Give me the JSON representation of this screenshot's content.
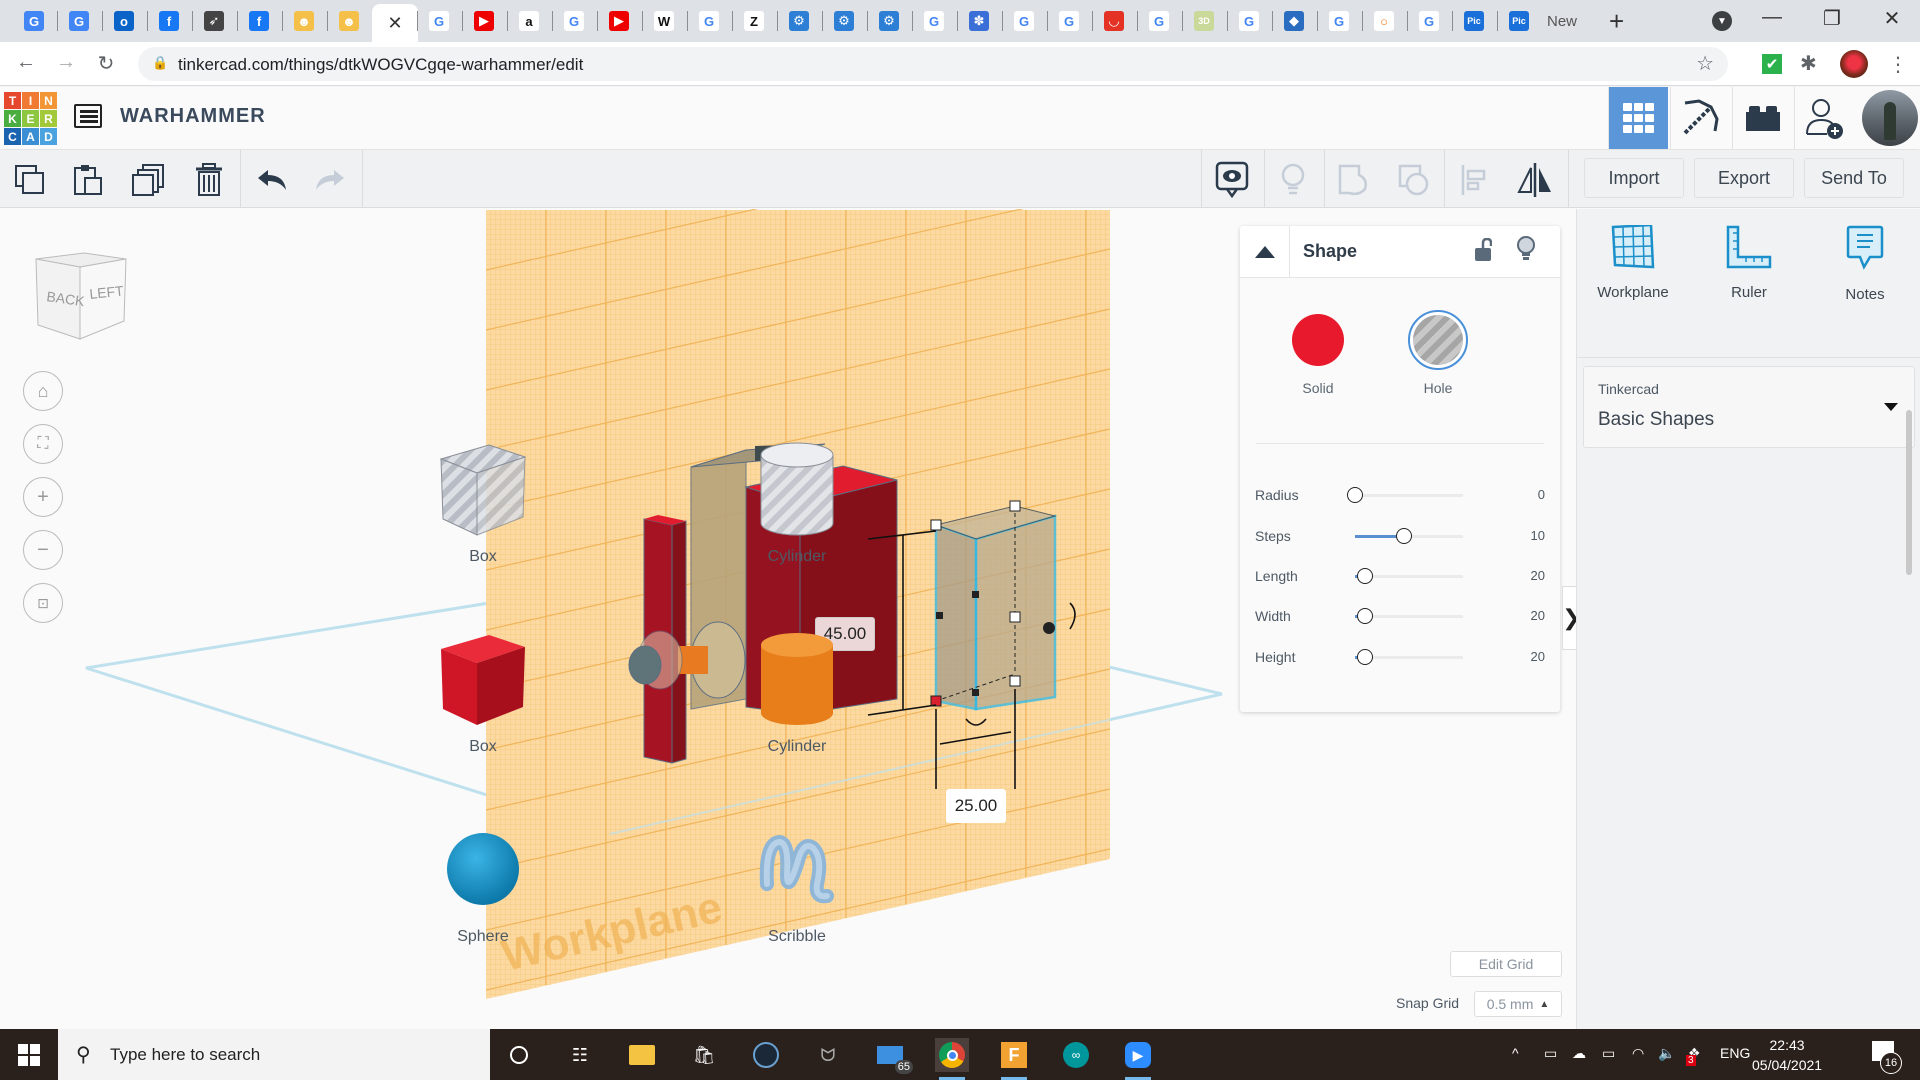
{
  "browser": {
    "tabs": [
      {
        "icon": "google-translate-icon"
      },
      {
        "icon": "google-translate-icon"
      },
      {
        "icon": "outlook-icon"
      },
      {
        "icon": "facebook-icon"
      },
      {
        "icon": "rocket-icon"
      },
      {
        "icon": "facebook-icon"
      },
      {
        "icon": "tinkercad-bot-icon"
      },
      {
        "icon": "tinkercad-bot-icon"
      },
      {
        "icon": "active-tab-close-icon",
        "active": true
      },
      {
        "icon": "google-icon"
      },
      {
        "icon": "youtube-icon"
      },
      {
        "icon": "amazon-icon"
      },
      {
        "icon": "google-icon"
      },
      {
        "icon": "youtube-icon"
      },
      {
        "icon": "wikipedia-icon"
      },
      {
        "icon": "google-icon"
      },
      {
        "icon": "z-icon"
      },
      {
        "icon": "gear-icon"
      },
      {
        "icon": "gear-icon"
      },
      {
        "icon": "gear-icon"
      },
      {
        "icon": "google-icon"
      },
      {
        "icon": "flower-icon"
      },
      {
        "icon": "google-icon"
      },
      {
        "icon": "google-icon"
      },
      {
        "icon": "aliexpress-icon"
      },
      {
        "icon": "google-icon"
      },
      {
        "icon": "3dp-block-icon"
      },
      {
        "icon": "google-icon"
      },
      {
        "icon": "cube-app-icon"
      },
      {
        "icon": "google-icon"
      },
      {
        "icon": "ring-icon"
      },
      {
        "icon": "google-icon"
      },
      {
        "icon": "pic-icon"
      },
      {
        "icon": "pic-icon"
      }
    ],
    "last_tab_label": "New",
    "url": "tinkercad.com/things/dtkWOGVCgqe-warhammer/edit"
  },
  "app": {
    "logo_letters": [
      "T",
      "I",
      "N",
      "K",
      "E",
      "R",
      "C",
      "A",
      "D"
    ],
    "logo_colors": [
      "#e5482c",
      "#f07a31",
      "#f19535",
      "#49ad3f",
      "#8dc63f",
      "#a2c93a",
      "#1b64b0",
      "#3a8fd4",
      "#4aa3df"
    ],
    "project_title": "WARHAMMER",
    "header_buttons": [
      "3d-view-grid-icon",
      "pickaxe-icon",
      "brick-icon",
      "add-user-icon"
    ]
  },
  "toolbar": {
    "import_label": "Import",
    "export_label": "Export",
    "send_to_label": "Send To"
  },
  "canvas": {
    "viewcube_faces": {
      "back": "BACK",
      "left": "LEFT"
    },
    "dimension_height": "45.00",
    "dimension_width": "25.00",
    "workplane_watermark": "Workplane"
  },
  "shape_panel": {
    "title": "Shape",
    "solid_label": "Solid",
    "hole_label": "Hole",
    "solid_color": "#e8192c",
    "selected_mode": "Hole",
    "properties": [
      {
        "label": "Radius",
        "value": "0",
        "fraction": 0.0
      },
      {
        "label": "Steps",
        "value": "10",
        "fraction": 0.45
      },
      {
        "label": "Length",
        "value": "20",
        "fraction": 0.09
      },
      {
        "label": "Width",
        "value": "20",
        "fraction": 0.09
      },
      {
        "label": "Height",
        "value": "20",
        "fraction": 0.09
      }
    ]
  },
  "grid": {
    "edit_grid_label": "Edit Grid",
    "snap_grid_label": "Snap Grid",
    "snap_grid_value": "0.5 mm"
  },
  "sidebar": {
    "tools": [
      {
        "label": "Workplane",
        "icon": "workplane-icon"
      },
      {
        "label": "Ruler",
        "icon": "ruler-icon"
      },
      {
        "label": "Notes",
        "icon": "notes-icon"
      }
    ],
    "library_source": "Tinkercad",
    "library_name": "Basic Shapes",
    "shapes": [
      {
        "label": "Box",
        "kind": "box-hole"
      },
      {
        "label": "Cylinder",
        "kind": "cylinder-hole"
      },
      {
        "label": "Box",
        "kind": "box-solid"
      },
      {
        "label": "Cylinder",
        "kind": "cylinder-solid"
      },
      {
        "label": "Sphere",
        "kind": "sphere"
      },
      {
        "label": "Scribble",
        "kind": "scribble"
      }
    ]
  },
  "taskbar": {
    "search_placeholder": "Type here to search",
    "apps": [
      "task-view-icon",
      "cortana-icon",
      "file-explorer-icon",
      "store-icon",
      "steam-icon",
      "predator-icon",
      "mail-icon",
      "chrome-icon",
      "fusion-icon",
      "arduino-icon",
      "zoom-icon"
    ],
    "mail_badge": "65",
    "language": "ENG",
    "dropbox_badge": "3",
    "time": "22:43",
    "date": "05/04/2021",
    "notifications_count": "16"
  }
}
